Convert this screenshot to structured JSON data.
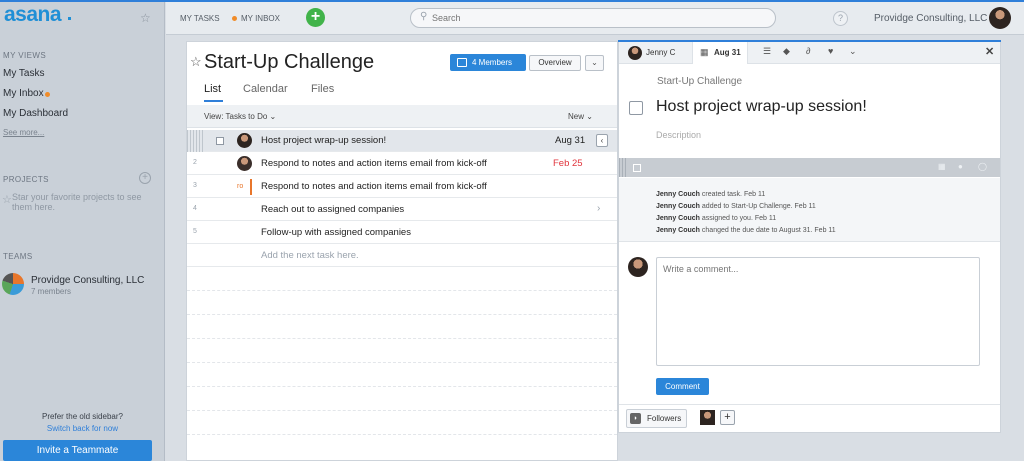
{
  "brand": {
    "logo": "asana",
    "accent": "#2b86d9"
  },
  "sidebar": {
    "my_views_heading": "MY VIEWS",
    "items": [
      {
        "label": "My Tasks"
      },
      {
        "label": "My Inbox"
      },
      {
        "label": "My Dashboard"
      }
    ],
    "see_more": "See more...",
    "projects_heading": "PROJECTS",
    "projects_hint": "Star your favorite projects to see them here.",
    "teams_heading": "TEAMS",
    "team": {
      "name": "Providge Consulting, LLC",
      "members": "7 members"
    },
    "old_sidebar_prompt": "Prefer the old sidebar?",
    "switch_back": "Switch back for now",
    "invite_button": "Invite a Teammate"
  },
  "topbar": {
    "my_tasks": "MY TASKS",
    "my_inbox": "MY INBOX",
    "add_icon": "plus",
    "search_placeholder": "Search",
    "help": "?",
    "org": "Providge Consulting, LLC"
  },
  "project": {
    "title": "Start-Up Challenge",
    "members_button": "4 Members",
    "overview_button": "Overview",
    "tabs": [
      {
        "label": "List"
      },
      {
        "label": "Calendar"
      },
      {
        "label": "Files"
      }
    ],
    "view_label": "View: Tasks to Do ⌄",
    "new_label": "New ⌄",
    "tasks": [
      {
        "num": "",
        "text": "Host project wrap-up session!",
        "date": "Aug 31"
      },
      {
        "num": "2",
        "text": "Respond to notes and action items email from kick-off",
        "date": "Feb 25"
      },
      {
        "num": "3",
        "assignee_initials": "ro",
        "text": "Respond to notes and action items email from kick-off",
        "date": ""
      },
      {
        "num": "4",
        "text": "Reach out to assigned companies",
        "date": ""
      },
      {
        "num": "5",
        "text": "Follow-up with assigned companies",
        "date": ""
      }
    ],
    "add_task_placeholder": "Add the next task here."
  },
  "detail": {
    "assignee": "Jenny C",
    "due": "Aug 31",
    "project": "Start-Up Challenge",
    "title": "Host project wrap-up session!",
    "description_placeholder": "Description",
    "activity": [
      {
        "who": "Jenny Couch",
        "what": "created task.",
        "when": "Feb 11"
      },
      {
        "who": "Jenny Couch",
        "what": "added to Start-Up Challenge.",
        "when": "Feb 11"
      },
      {
        "who": "Jenny Couch",
        "what": "assigned to you.",
        "when": "Feb 11"
      },
      {
        "who": "Jenny Couch",
        "what": "changed the due date to August 31.",
        "when": "Feb 11"
      }
    ],
    "comment_placeholder": "Write a comment...",
    "comment_button": "Comment",
    "followers_button": "Followers"
  }
}
